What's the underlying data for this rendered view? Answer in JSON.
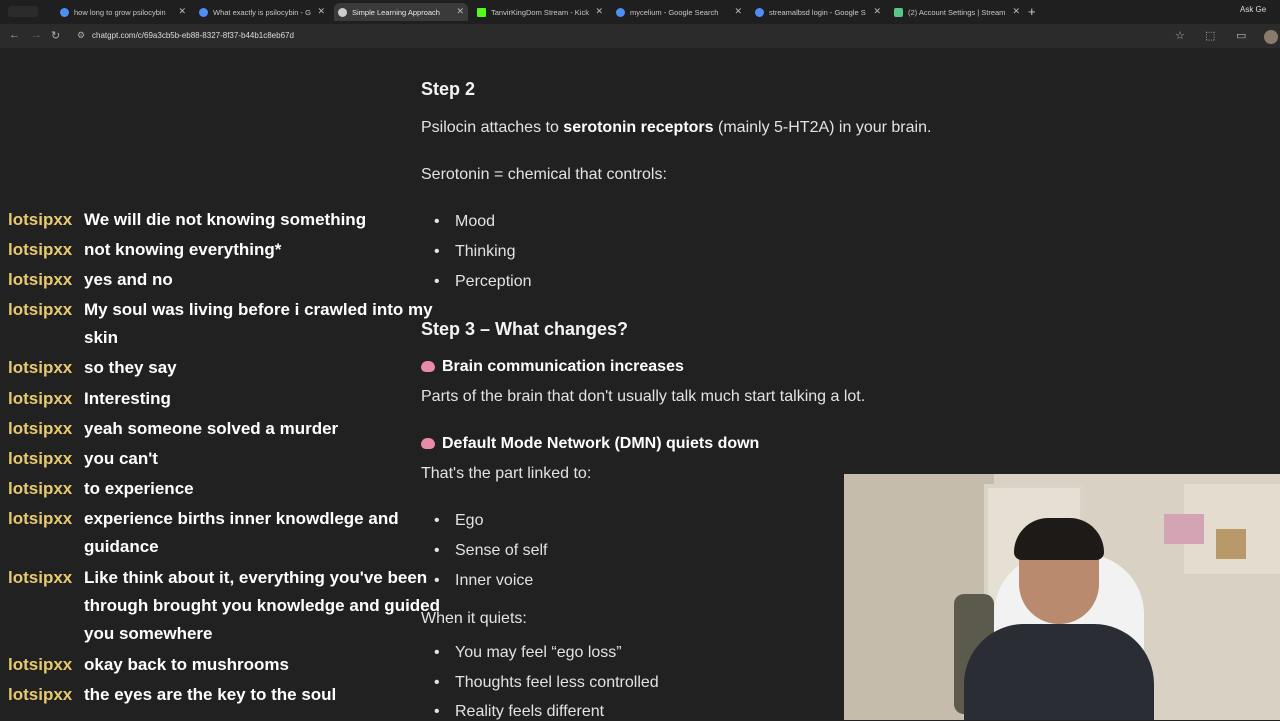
{
  "browser": {
    "tabs": [
      {
        "title": "how long to grow psilocybin",
        "fav": "#4d8ef7"
      },
      {
        "title": "What exactly is psilocybin - G",
        "fav": "#4d8ef7"
      },
      {
        "title": "Simple Learning Approach",
        "fav": "#cccccc",
        "active": true
      },
      {
        "title": "TanvirKingDom Stream - Kick",
        "fav": "#53fc18"
      },
      {
        "title": "mycelium - Google Search",
        "fav": "#4d8ef7"
      },
      {
        "title": "streamalbsd login - Google S",
        "fav": "#4d8ef7"
      },
      {
        "title": "(2) Account Settings | Stream",
        "fav": "#57c785"
      }
    ],
    "url": "chatgpt.com/c/69a3cb5b-eb88-8327-8f37-b44b1c8eb67d",
    "ask_label": "Ask Ge"
  },
  "chat": [
    {
      "user": "lotsipxx",
      "text": "We will die not knowing something"
    },
    {
      "user": "lotsipxx",
      "text": "not knowing everything*"
    },
    {
      "user": "lotsipxx",
      "text": "yes and no"
    },
    {
      "user": "lotsipxx",
      "text": "My soul was living before i crawled into my skin"
    },
    {
      "user": "lotsipxx",
      "text": "so they say"
    },
    {
      "user": "lotsipxx",
      "text": "Interesting"
    },
    {
      "user": "lotsipxx",
      "text": "yeah someone solved a murder"
    },
    {
      "user": "lotsipxx",
      "text": "you can't"
    },
    {
      "user": "lotsipxx",
      "text": "to experience"
    },
    {
      "user": "lotsipxx",
      "text": "experience births inner knowdlege and guidance"
    },
    {
      "user": "lotsipxx",
      "text": "Like think about it, everything you've been through brought you knowledge and guided you somewhere"
    },
    {
      "user": "lotsipxx",
      "text": "okay back to mushrooms"
    },
    {
      "user": "lotsipxx",
      "text": "the eyes are the key to the soul"
    }
  ],
  "doc": {
    "step2_title": "Step 2",
    "step2_pre": "Psilocin attaches to ",
    "step2_bold": "serotonin receptors",
    "step2_post": " (mainly 5-HT2A) in your brain.",
    "serotonin_line": "Serotonin = chemical that controls:",
    "controls": [
      "Mood",
      "Thinking",
      "Perception"
    ],
    "step3_title": "Step 3 – What changes?",
    "brain_heading": "Brain communication increases",
    "brain_text": "Parts of the brain that don't usually talk much start talking a lot.",
    "dmn_heading": "Default Mode Network (DMN) quiets down",
    "dmn_text": "That's the part linked to:",
    "dmn_items": [
      "Ego",
      "Sense of self",
      "Inner voice"
    ],
    "quiet_text": "When it quiets:",
    "quiet_items": [
      "You may feel “ego loss”",
      "Thoughts feel less controlled",
      "Reality feels different"
    ]
  }
}
